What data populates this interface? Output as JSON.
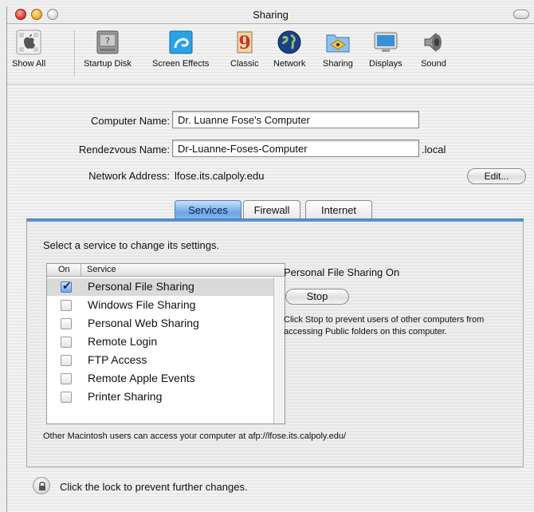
{
  "window": {
    "title": "Sharing"
  },
  "toolbar": {
    "items": [
      {
        "label": "Show All",
        "icon": "apple-grid-icon"
      },
      {
        "label": "Startup Disk",
        "icon": "hard-disk-icon"
      },
      {
        "label": "Screen Effects",
        "icon": "screen-effects-icon"
      },
      {
        "label": "Classic",
        "icon": "classic-9-icon"
      },
      {
        "label": "Network",
        "icon": "globe-icon"
      },
      {
        "label": "Sharing",
        "icon": "sharing-folder-icon"
      },
      {
        "label": "Displays",
        "icon": "display-icon"
      },
      {
        "label": "Sound",
        "icon": "speaker-icon"
      }
    ]
  },
  "form": {
    "computer_name_label": "Computer Name:",
    "computer_name_value": "Dr. Luanne Fose's Computer",
    "rendezvous_label": "Rendezvous Name:",
    "rendezvous_value": "Dr-Luanne-Foses-Computer",
    "rendezvous_suffix": ".local",
    "network_label": "Network Address:",
    "network_value": "lfose.its.calpoly.edu",
    "edit_button": "Edit..."
  },
  "tabs": {
    "items": [
      "Services",
      "Firewall",
      "Internet"
    ],
    "active": "Services"
  },
  "services": {
    "instruction": "Select a service to change its settings.",
    "col_on": "On",
    "col_service": "Service",
    "rows": [
      {
        "name": "Personal File Sharing",
        "checked": true,
        "selected": true
      },
      {
        "name": "Windows File Sharing",
        "checked": false,
        "selected": false
      },
      {
        "name": "Personal Web Sharing",
        "checked": false,
        "selected": false
      },
      {
        "name": "Remote Login",
        "checked": false,
        "selected": false
      },
      {
        "name": "FTP Access",
        "checked": false,
        "selected": false
      },
      {
        "name": "Remote Apple Events",
        "checked": false,
        "selected": false
      },
      {
        "name": "Printer Sharing",
        "checked": false,
        "selected": false
      }
    ],
    "status_title": "Personal File Sharing On",
    "stop_button": "Stop",
    "status_desc": "Click Stop to prevent users of other computers from accessing Public folders on this computer.",
    "footer_note": "Other Macintosh users can access your computer at afp://lfose.its.calpoly.edu/"
  },
  "lock": {
    "text": "Click the lock to prevent further changes.",
    "icon": "lock-icon"
  },
  "colors": {
    "tab_active": "#6aa7e6",
    "tab_line": "#5e94cf",
    "checkbox_on": "#6da7e6"
  }
}
